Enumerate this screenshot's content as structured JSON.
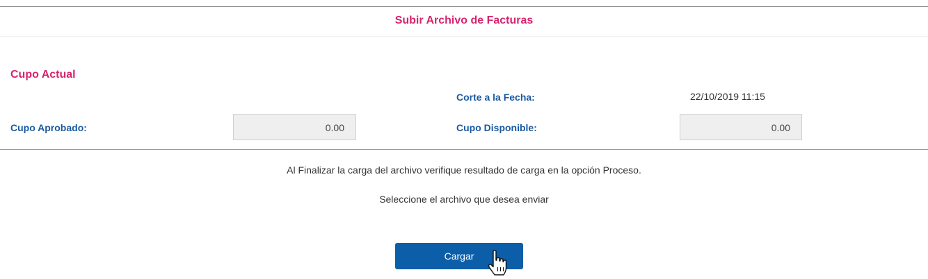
{
  "header": {
    "title": "Subir Archivo de Facturas"
  },
  "cupo": {
    "section_title": "Cupo Actual",
    "corte_label": "Corte a la Fecha:",
    "corte_value": "22/10/2019 11:15",
    "aprobado_label": "Cupo Aprobado:",
    "aprobado_value": "0.00",
    "disponible_label": "Cupo Disponible:",
    "disponible_value": "0.00"
  },
  "upload": {
    "notice": "Al Finalizar la carga del archivo verifique resultado de carga en la opción Proceso.",
    "instruction": "Seleccione el archivo que desea enviar",
    "button_label": "Cargar"
  },
  "colors": {
    "accent": "#d6246e",
    "label": "#1b5aa0",
    "button": "#0d5ea8"
  },
  "icons": {
    "cursor": "hand-pointer-icon"
  }
}
